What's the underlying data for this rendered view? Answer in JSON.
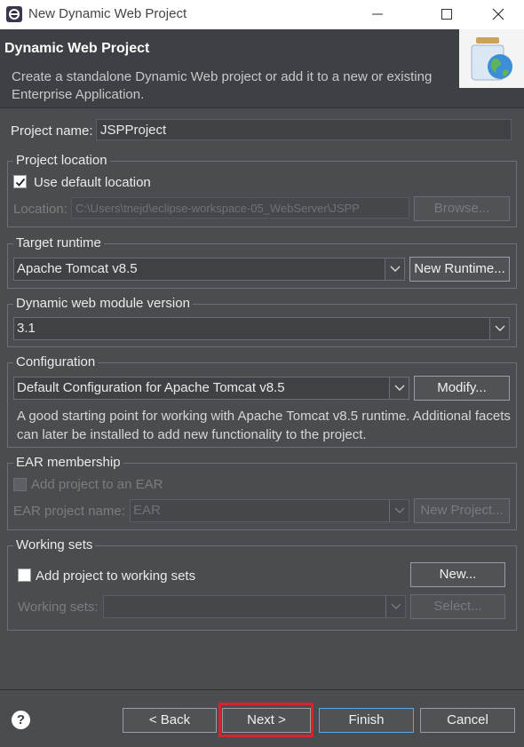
{
  "window": {
    "title": "New Dynamic Web Project",
    "minimize_icon": "minimize-icon",
    "maximize_icon": "maximize-icon",
    "close_icon": "close-icon"
  },
  "header": {
    "title": "Dynamic Web Project",
    "description": "Create a standalone Dynamic Web project or add it to a new or existing Enterprise Application."
  },
  "project_name": {
    "label": "Project name:",
    "value": "JSPProject"
  },
  "project_location": {
    "group_label": "Project location",
    "use_default_label": "Use default location",
    "use_default_checked": true,
    "location_label": "Location:",
    "location_value": "C:\\Users\\tnejd\\eclipse-workspace-05_WebServer\\JSPP",
    "browse_label": "Browse..."
  },
  "target_runtime": {
    "group_label": "Target runtime",
    "value": "Apache Tomcat v8.5",
    "new_runtime_label": "New Runtime..."
  },
  "module_version": {
    "group_label": "Dynamic web module version",
    "value": "3.1"
  },
  "configuration": {
    "group_label": "Configuration",
    "value": "Default Configuration for Apache Tomcat v8.5",
    "modify_label": "Modify...",
    "description": "A good starting point for working with Apache Tomcat v8.5 runtime. Additional facets can later be installed to add new functionality to the project."
  },
  "ear": {
    "group_label": "EAR membership",
    "add_label": "Add project to an EAR",
    "add_checked": false,
    "project_name_label": "EAR project name:",
    "project_name_value": "EAR",
    "new_project_label": "New Project..."
  },
  "working_sets": {
    "group_label": "Working sets",
    "add_label": "Add project to working sets",
    "add_checked": false,
    "new_label": "New...",
    "sets_label": "Working sets:",
    "sets_value": "",
    "select_label": "Select..."
  },
  "footer": {
    "help_icon": "help-icon",
    "back_label": "< Back",
    "next_label": "Next >",
    "finish_label": "Finish",
    "cancel_label": "Cancel"
  },
  "colors": {
    "background": "#4a4d50",
    "header": "#3d4044",
    "highlight": "#d8232a"
  }
}
